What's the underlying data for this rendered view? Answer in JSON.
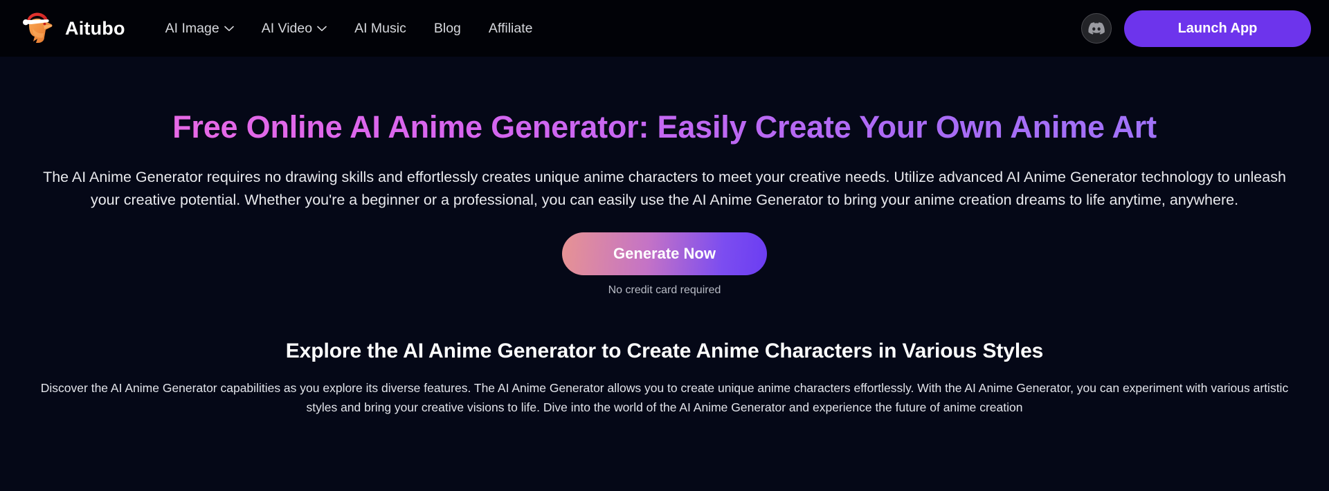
{
  "site": {
    "brand_name": "Aitubo",
    "logo_icon": "fox-santa-hat-logo"
  },
  "header": {
    "nav": [
      {
        "label": "AI Image",
        "has_dropdown": true,
        "icon": "chevron-down-icon"
      },
      {
        "label": "AI Video",
        "has_dropdown": true,
        "icon": "chevron-down-icon"
      },
      {
        "label": "AI Music",
        "has_dropdown": false,
        "icon": ""
      },
      {
        "label": "Blog",
        "has_dropdown": false,
        "icon": ""
      },
      {
        "label": "Affiliate",
        "has_dropdown": false,
        "icon": ""
      }
    ],
    "discord_icon": "discord-icon",
    "launch_label": "Launch App"
  },
  "hero": {
    "title": "Free Online AI Anime Generator: Easily Create Your Own Anime Art",
    "subtitle": "The AI Anime Generator requires no drawing skills and effortlessly creates unique anime characters to meet your creative needs. Utilize advanced AI Anime Generator technology to unleash your creative potential. Whether you're a beginner or a professional, you can easily use the AI Anime Generator to bring your anime creation dreams to life anytime, anywhere.",
    "cta_label": "Generate Now",
    "cta_note": "No credit card required"
  },
  "section": {
    "title": "Explore the AI Anime Generator to Create Anime Characters in Various Styles",
    "body": "Discover the AI Anime Generator capabilities as you explore its diverse features. The AI Anime Generator allows you to create unique anime characters effortlessly. With the AI Anime Generator, you can experiment with various artistic styles and bring your creative visions to life. Dive into the world of the AI Anime Generator and experience the future of anime creation"
  },
  "colors": {
    "header_bg": "#010207",
    "page_bg": "#050817",
    "accent_purple": "#6d34ec",
    "gradient_pink": "#f06ce0",
    "gradient_violet": "#9b78fb",
    "cta_gradient_left": "#e79393",
    "cta_gradient_right": "#6b3df2"
  }
}
